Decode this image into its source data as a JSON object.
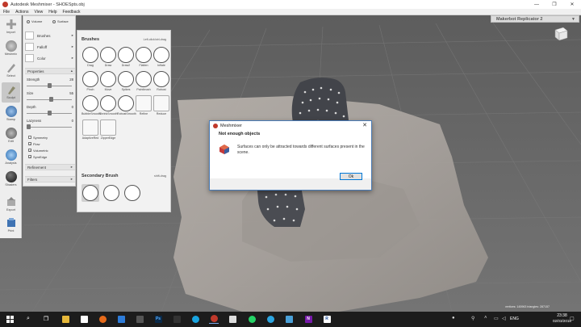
{
  "window": {
    "title": "Autodesk Meshmixer - SHOESpts.obj",
    "buttons": [
      "—",
      "❐",
      "✕"
    ]
  },
  "menu": [
    "File",
    "Actions",
    "View",
    "Help",
    "Feedback"
  ],
  "printer": {
    "name": "Makerbot Replicator 2",
    "arrow": "▼"
  },
  "toolbar": [
    {
      "name": "import",
      "label": "Import",
      "color": "#999999"
    },
    {
      "name": "meshmix",
      "label": "Meshmix",
      "color": "#8a8a8a"
    },
    {
      "name": "select",
      "label": "Select",
      "color": "#a0a0a0"
    },
    {
      "name": "sculpt",
      "label": "Sculpt",
      "color": "#9a9a7a"
    },
    {
      "name": "stamp",
      "label": "Stamp",
      "color": "#4a7ab0"
    },
    {
      "name": "edit",
      "label": "Edit",
      "color": "#777777"
    },
    {
      "name": "analysis",
      "label": "Analysis",
      "color": "#4a86c0"
    },
    {
      "name": "shaders",
      "label": "Shaders",
      "color": "#222222"
    },
    {
      "name": "export",
      "label": "Export",
      "color": "#aaaaaa"
    },
    {
      "name": "print",
      "label": "Print",
      "color": "#4a7ab0"
    }
  ],
  "sculpt": {
    "mode_volume": "Volume",
    "mode_surface": "Surface",
    "brushes_label": "Brushes",
    "falloff_label": "Falloff",
    "color_label": "Color",
    "properties_label": "Properties",
    "strength_label": "Strength",
    "strength_value": "28",
    "strength_level": 0.5,
    "size_label": "Size",
    "size_value": "55",
    "size_level": 0.55,
    "depth_label": "Depth",
    "depth_value": "0",
    "depth_level": 0.5,
    "lazyness_label": "Lazyness",
    "lazyness_value": "0",
    "lazyness_level": 0.0,
    "symmetry_label": "Symmetry",
    "flow_label": "Flow",
    "volumetric_label": "Volumetric",
    "symedge_label": "SymEdge",
    "refinement_label": "Refinement",
    "filters_label": "Filters"
  },
  "brushes": {
    "title": "Brushes",
    "hint": "Left-click/ctrl-drag",
    "items": [
      "Drag",
      "Draw",
      "Draw2",
      "Flatten",
      "Inflate",
      "Pinch",
      "Move",
      "Spikes",
      "Paintbrush",
      "Robust",
      "BubbleSmooth",
      "ShrinkSmooth",
      "RobustSmooth",
      "Refine",
      "Reduce",
      "AdaptiveRed",
      "ZipperEdge"
    ],
    "secondary_title": "Secondary Brush",
    "secondary_hint": "shift-drag"
  },
  "dialog": {
    "title": "Meshmixer",
    "heading": "Not enough objects",
    "message": "Surfaces can only be attracted towards different surfaces present in the scene.",
    "ok": "Ok",
    "close": "✕"
  },
  "status": "vertices: 145963  triangles: 287157",
  "taskbar": {
    "time": "23:38",
    "date": "02/03/2018",
    "lang": "ENG"
  }
}
